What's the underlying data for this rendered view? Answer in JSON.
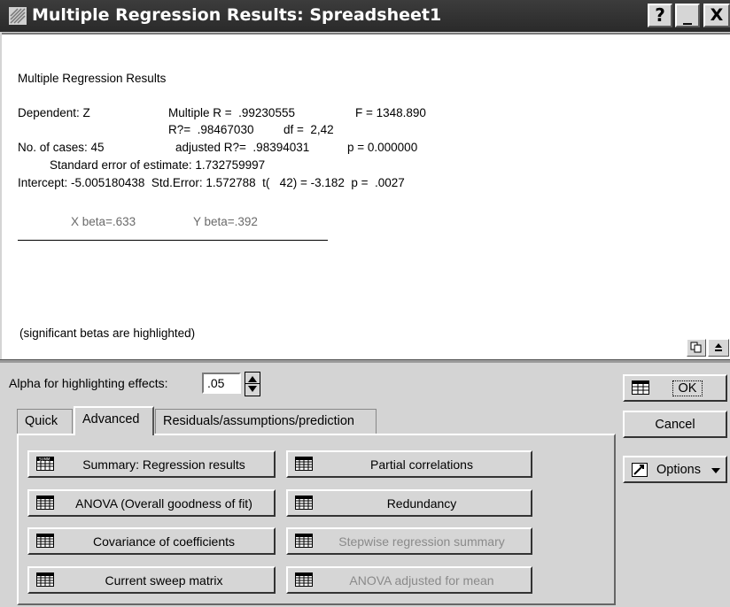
{
  "window": {
    "title": "Multiple Regression Results: Spreadsheet1",
    "help_label": "?",
    "minimize_label": "_",
    "close_label": "X"
  },
  "results": {
    "heading": "Multiple Regression Results",
    "dependent": "Dependent: Z",
    "multiple_r": "Multiple R =  .99230555",
    "f_value": "F = 1348.890",
    "r_squared": "R?=  .98467030",
    "df": "df =  2,42",
    "n_cases": "No. of cases: 45",
    "adjusted_r": "adjusted R?=  .98394031",
    "p_value": "p = 0.000000",
    "std_error_est": "Standard error of estimate: 1.732759997",
    "intercept_line": "Intercept: -5.005180438  Std.Error: 1.572788  t(   42) = -3.182  p =  .0027",
    "x_beta": "X beta=.633",
    "y_beta": "Y beta=.392",
    "footnote": "(significant betas are highlighted)"
  },
  "alpha": {
    "label": "Alpha for highlighting effects:",
    "value": ".05"
  },
  "tabs": [
    {
      "label": "Quick"
    },
    {
      "label": "Advanced"
    },
    {
      "label": "Residuals/assumptions/prediction"
    }
  ],
  "buttons": {
    "summary": "Summary:  Regression results",
    "partial": "Partial correlations",
    "anova": "ANOVA (Overall goodness of fit)",
    "redundancy": "Redundancy",
    "covariance": "Covariance of coefficients",
    "stepwise": "Stepwise regression summary",
    "sweep": "Current sweep matrix",
    "anova_mean": "ANOVA adjusted for mean"
  },
  "side": {
    "ok": "OK",
    "cancel": "Cancel",
    "options": "Options"
  }
}
